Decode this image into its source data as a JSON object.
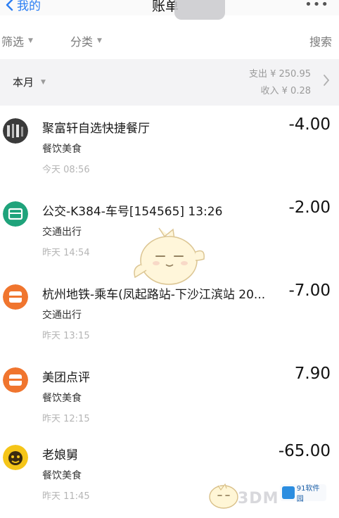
{
  "nav": {
    "back_label": "我的",
    "title": "账单",
    "more": "•••"
  },
  "filters": {
    "filter": "筛选",
    "category": "分类",
    "search": "搜索"
  },
  "summary": {
    "month": "本月",
    "expense": "支出 ¥ 250.95",
    "income": "收入 ¥ 0.28"
  },
  "transactions": [
    {
      "title": "聚富轩自选快捷餐厅",
      "amount": "-4.00",
      "category": "餐饮美食",
      "time": "今天  08:56",
      "icon": "restaurant-avatar"
    },
    {
      "title": "公交-K384-车号[154565] 13:26",
      "amount": "-2.00",
      "category": "交通出行",
      "time": "昨天  14:54",
      "icon": "bus-icon"
    },
    {
      "title": "杭州地铁-乘车(凤起路站-下沙江滨站 20...",
      "amount": "-7.00",
      "category": "交通出行",
      "time": "昨天  13:15",
      "icon": "metro-icon"
    },
    {
      "title": "美团点评",
      "amount": "7.90",
      "category": "餐饮美食",
      "time": "昨天  12:15",
      "icon": "meituan-icon"
    },
    {
      "title": "老娘舅",
      "amount": "-65.00",
      "category": "餐饮美食",
      "time": "昨天  11:45",
      "icon": "laoniangjiu-icon"
    }
  ],
  "watermark": {
    "text": "3DM",
    "badge": "91软件园"
  },
  "colors": {
    "accent": "#2d7ff3",
    "bus_green": "#1fa37b",
    "metro_orange": "#f0752e",
    "meituan_orange": "#f0752e",
    "laoniangjiu_yellow": "#f5c518"
  }
}
